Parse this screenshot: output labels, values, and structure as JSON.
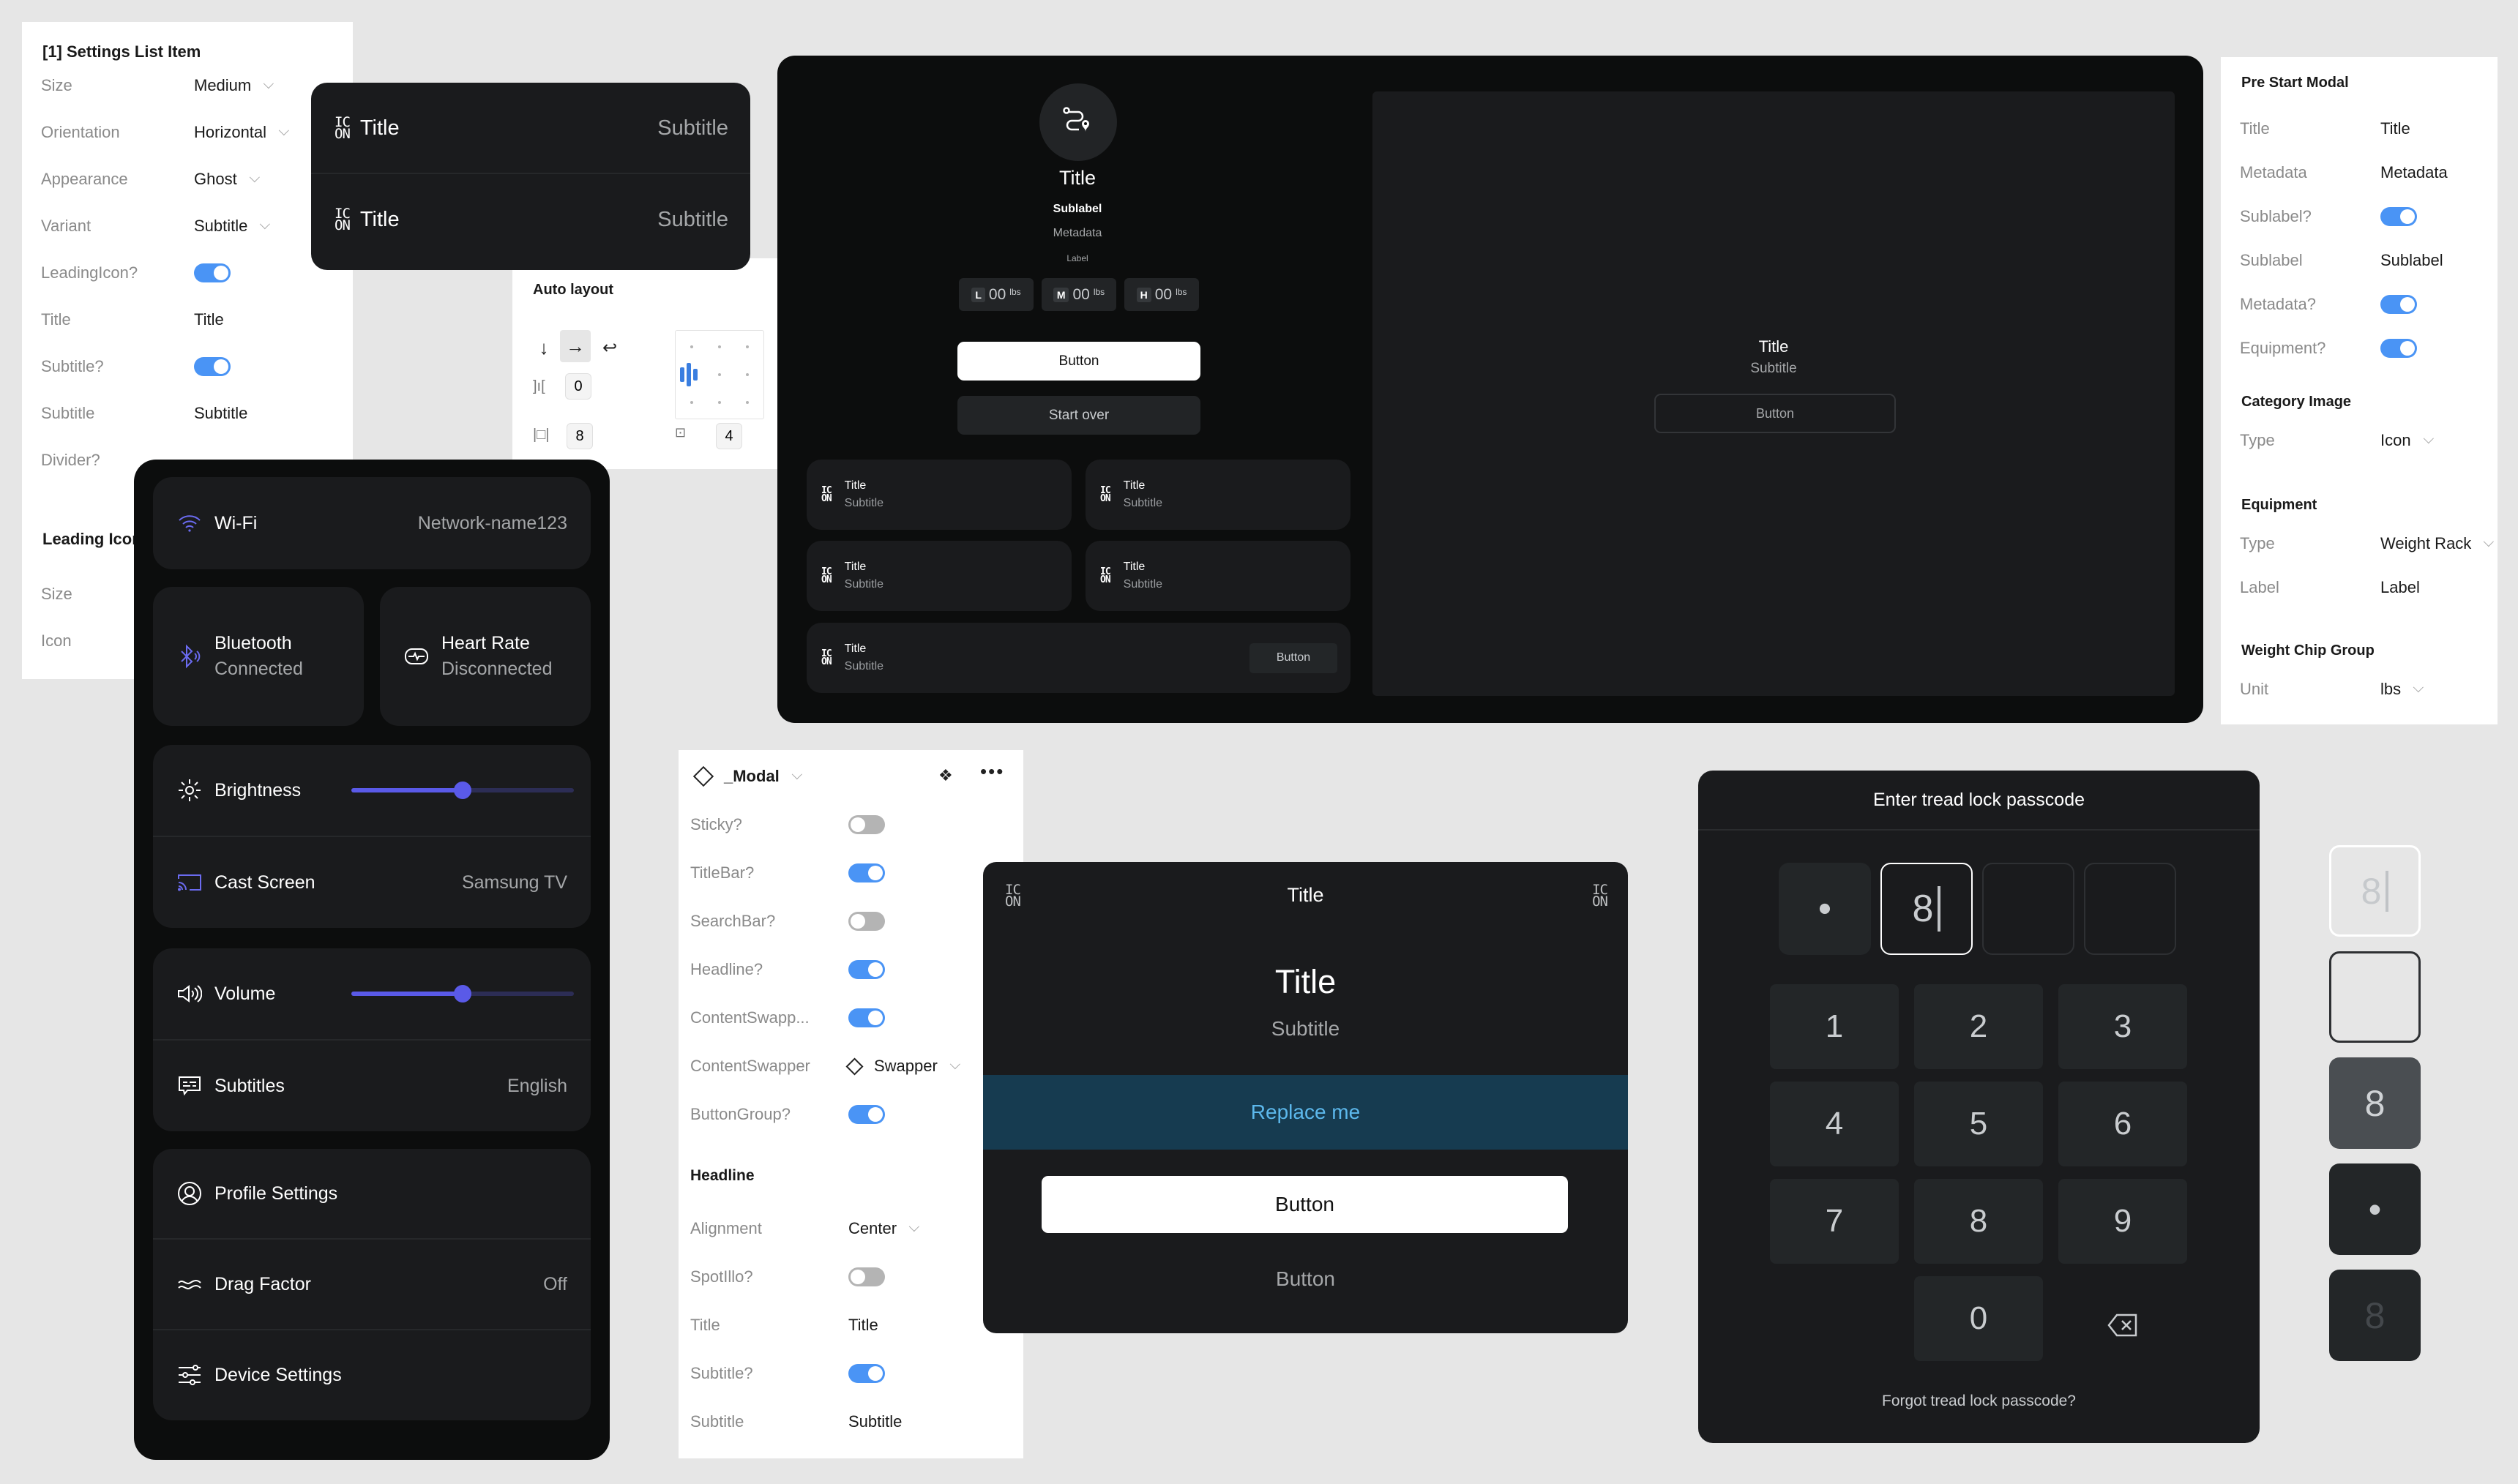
{
  "settings_list_item_panel": {
    "heading": "[1] Settings List Item",
    "rows": [
      {
        "label": "Size",
        "value": "Medium",
        "type": "dropdown"
      },
      {
        "label": "Orientation",
        "value": "Horizontal",
        "type": "dropdown"
      },
      {
        "label": "Appearance",
        "value": "Ghost",
        "type": "dropdown"
      },
      {
        "label": "Variant",
        "value": "Subtitle",
        "type": "dropdown"
      },
      {
        "label": "LeadingIcon?",
        "value": true,
        "type": "toggle"
      },
      {
        "label": "Title",
        "value": "Title",
        "type": "text"
      },
      {
        "label": "Subtitle?",
        "value": true,
        "type": "toggle"
      },
      {
        "label": "Subtitle",
        "value": "Subtitle",
        "type": "text"
      },
      {
        "label": "Divider?",
        "type": "toggle-hidden"
      }
    ],
    "leading_icon_heading": "Leading Icon",
    "leading_icon_rows": [
      {
        "label": "Size"
      },
      {
        "label": "Icon"
      }
    ]
  },
  "list_preview": {
    "items": [
      {
        "icon": "placeholder-icon",
        "icon_text_top": "IC",
        "icon_text_bottom": "ON",
        "title": "Title",
        "subtitle": "Subtitle"
      },
      {
        "icon": "placeholder-icon",
        "icon_text_top": "IC",
        "icon_text_bottom": "ON",
        "title": "Title",
        "subtitle": "Subtitle"
      }
    ]
  },
  "auto_layout": {
    "heading": "Auto layout",
    "direction_options": [
      "vertical",
      "horizontal",
      "wrap"
    ],
    "direction_selected": "horizontal",
    "gap": "0",
    "padding_horizontal": "8",
    "padding_vertical": "4",
    "alignment": "middle-left"
  },
  "pre_start_preview": {
    "category_icon": "route-pin-icon",
    "title": "Title",
    "sublabel": "Sublabel",
    "metadata": "Metadata",
    "label": "Label",
    "weight_chips": [
      {
        "level": "L",
        "value": "00",
        "unit": "lbs"
      },
      {
        "level": "M",
        "value": "00",
        "unit": "lbs"
      },
      {
        "level": "H",
        "value": "00",
        "unit": "lbs"
      }
    ],
    "primary_button": "Button",
    "secondary_button": "Start over",
    "tiles": [
      {
        "title": "Title",
        "subtitle": "Subtitle"
      },
      {
        "title": "Title",
        "subtitle": "Subtitle"
      },
      {
        "title": "Title",
        "subtitle": "Subtitle"
      },
      {
        "title": "Title",
        "subtitle": "Subtitle"
      },
      {
        "title": "Title",
        "subtitle": "Subtitle",
        "button": "Button"
      }
    ],
    "icon_text_top": "IC",
    "icon_text_bottom": "ON",
    "empty_state": {
      "title": "Title",
      "subtitle": "Subtitle",
      "button": "Button"
    }
  },
  "pre_start_modal_panel": {
    "heading": "Pre Start Modal",
    "rows": [
      {
        "label": "Title",
        "value": "Title",
        "type": "text"
      },
      {
        "label": "Metadata",
        "value": "Metadata",
        "type": "text"
      },
      {
        "label": "Sublabel?",
        "value": true,
        "type": "toggle"
      },
      {
        "label": "Sublabel",
        "value": "Sublabel",
        "type": "text"
      },
      {
        "label": "Metadata?",
        "value": true,
        "type": "toggle"
      },
      {
        "label": "Equipment?",
        "value": true,
        "type": "toggle"
      }
    ],
    "category_image": {
      "heading": "Category Image",
      "rows": [
        {
          "label": "Type",
          "value": "Icon",
          "type": "dropdown"
        }
      ]
    },
    "equipment": {
      "heading": "Equipment",
      "rows": [
        {
          "label": "Type",
          "value": "Weight Rack",
          "type": "dropdown"
        },
        {
          "label": "Label",
          "value": "Label",
          "type": "text"
        }
      ]
    },
    "weight_chip_group": {
      "heading": "Weight Chip Group",
      "rows": [
        {
          "label": "Unit",
          "value": "lbs",
          "type": "dropdown"
        }
      ]
    }
  },
  "device_settings": {
    "wifi": {
      "label": "Wi-Fi",
      "value": "Network-name123",
      "icon": "wifi-icon"
    },
    "bluetooth": {
      "label": "Bluetooth",
      "status": "Connected",
      "icon": "bluetooth-icon"
    },
    "heart_rate": {
      "label": "Heart Rate",
      "status": "Disconnected",
      "icon": "heart-rate-icon"
    },
    "brightness": {
      "label": "Brightness",
      "level": 0.5,
      "icon": "brightness-icon"
    },
    "cast": {
      "label": "Cast Screen",
      "value": "Samsung TV",
      "icon": "cast-icon"
    },
    "volume": {
      "label": "Volume",
      "level": 0.5,
      "icon": "volume-icon"
    },
    "subtitles": {
      "label": "Subtitles",
      "value": "English",
      "icon": "subtitles-icon"
    },
    "profile": {
      "label": "Profile Settings",
      "icon": "profile-icon"
    },
    "drag": {
      "label": "Drag Factor",
      "value": "Off",
      "icon": "drag-icon"
    },
    "device": {
      "label": "Device Settings",
      "icon": "sliders-icon"
    },
    "accent": "#5a5ae8"
  },
  "modal_panel": {
    "component": "_Modal",
    "rows": [
      {
        "label": "Sticky?",
        "value": false,
        "type": "toggle"
      },
      {
        "label": "TitleBar?",
        "value": true,
        "type": "toggle"
      },
      {
        "label": "SearchBar?",
        "value": false,
        "type": "toggle"
      },
      {
        "label": "Headline?",
        "value": true,
        "type": "toggle"
      },
      {
        "label": "ContentSwapp...",
        "value": true,
        "type": "toggle"
      },
      {
        "label": "ContentSwapper",
        "value": "Swapper",
        "type": "instance"
      },
      {
        "label": "ButtonGroup?",
        "value": true,
        "type": "toggle"
      }
    ],
    "headline": {
      "heading": "Headline",
      "rows": [
        {
          "label": "Alignment",
          "value": "Center",
          "type": "dropdown"
        },
        {
          "label": "SpotIllo?",
          "value": false,
          "type": "toggle"
        },
        {
          "label": "Title",
          "value": "Title",
          "type": "text"
        },
        {
          "label": "Subtitle?",
          "value": true,
          "type": "toggle"
        },
        {
          "label": "Subtitle",
          "value": "Subtitle",
          "type": "text"
        }
      ]
    }
  },
  "modal_preview": {
    "titlebar_title": "Title",
    "headline_title": "Title",
    "headline_subtitle": "Subtitle",
    "swapper_text": "Replace me",
    "primary_button": "Button",
    "secondary_button": "Button",
    "icon_text_top": "IC",
    "icon_text_bottom": "ON",
    "swapper_bg": "#163b50",
    "swapper_color": "#5cb8ec"
  },
  "passcode": {
    "title": "Enter tread lock passcode",
    "slots": [
      {
        "state": "filled-masked",
        "display": "•"
      },
      {
        "state": "active",
        "display": "8"
      },
      {
        "state": "empty",
        "display": ""
      },
      {
        "state": "empty",
        "display": ""
      }
    ],
    "keys": [
      "1",
      "2",
      "3",
      "4",
      "5",
      "6",
      "7",
      "8",
      "9",
      "0"
    ],
    "backspace_icon": "backspace-icon",
    "forgot_link": "Forgot tread lock passcode?"
  },
  "slot_states": [
    {
      "state": "active",
      "display": "8"
    },
    {
      "state": "empty",
      "display": ""
    },
    {
      "state": "pressed",
      "display": "8"
    },
    {
      "state": "masked",
      "display": "•"
    },
    {
      "state": "disabled",
      "display": "8"
    }
  ]
}
